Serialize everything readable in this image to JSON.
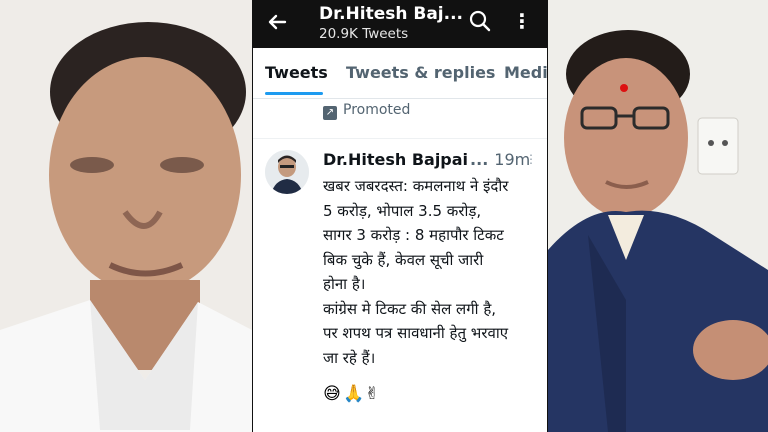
{
  "header": {
    "title": "Dr.Hitesh Baj...",
    "tweet_count": "20.9K Tweets"
  },
  "tabs": [
    {
      "label": "Tweets",
      "active": true
    },
    {
      "label": "Tweets & replies",
      "active": false
    },
    {
      "label": "Medi",
      "active": false
    }
  ],
  "promoted": {
    "label": "Promoted"
  },
  "tweet": {
    "author": "Dr.Hitesh Bajpai",
    "ellipsis": "...",
    "time": "19m",
    "text": "खबर जबरदस्त: कमलनाथ ने इंदौर\n5 करोड़, भोपाल 3.5 करोड़,\nसागर 3 करोड़ : 8 महापौर टिकट\nबिक चुके हैं, केवल सूची जारी\nहोना है।\nकांग्रेस मे टिकट की सेल लगी है,\nपर शपथ पत्र सावधानी हेतु भरवाए\nजा रहे हैं।",
    "emojis": [
      "😅",
      "🙏",
      "✌"
    ]
  },
  "colors": {
    "appbar": "#111111",
    "accent": "#1d9bf0",
    "muted": "#536471"
  },
  "icons": {
    "back": "arrow-left-icon",
    "search": "search-icon",
    "more": "more-vertical-icon",
    "promoted": "promoted-icon"
  }
}
